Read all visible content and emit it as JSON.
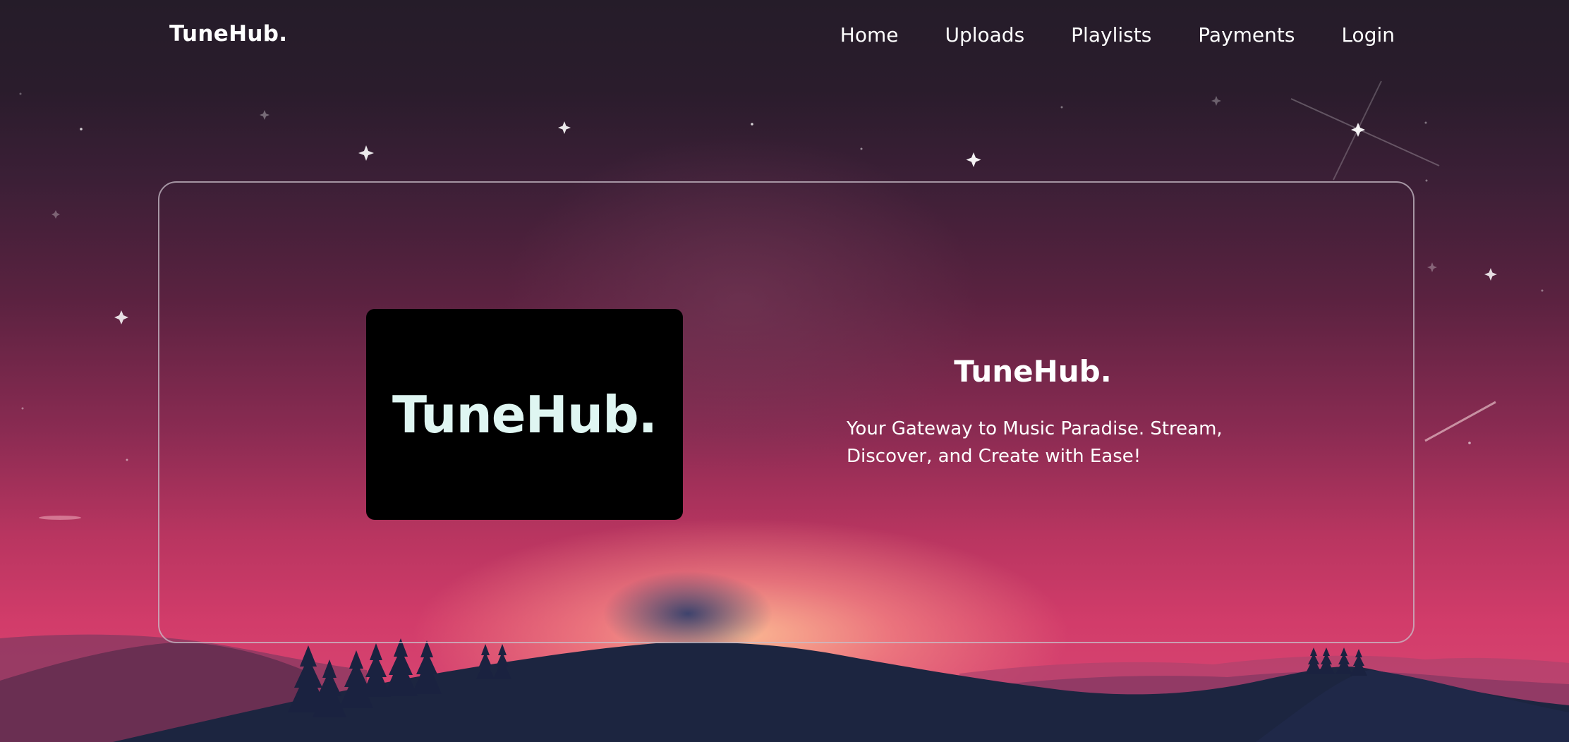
{
  "nav": {
    "brand": "TuneHub.",
    "links": [
      {
        "label": "Home"
      },
      {
        "label": "Uploads"
      },
      {
        "label": "Playlists"
      },
      {
        "label": "Payments"
      },
      {
        "label": "Login"
      }
    ]
  },
  "hero": {
    "logo_text": "TuneHub.",
    "title": "TuneHub.",
    "tagline": "Your Gateway to Music Paradise. Stream, Discover, and Create with Ease!"
  },
  "colors": {
    "text": "#ffffff",
    "logo_tile_bg": "#000000",
    "logo_text": "#dff6f2",
    "card_border": "#c8bec8",
    "mountain_dark": "#1c2540"
  }
}
